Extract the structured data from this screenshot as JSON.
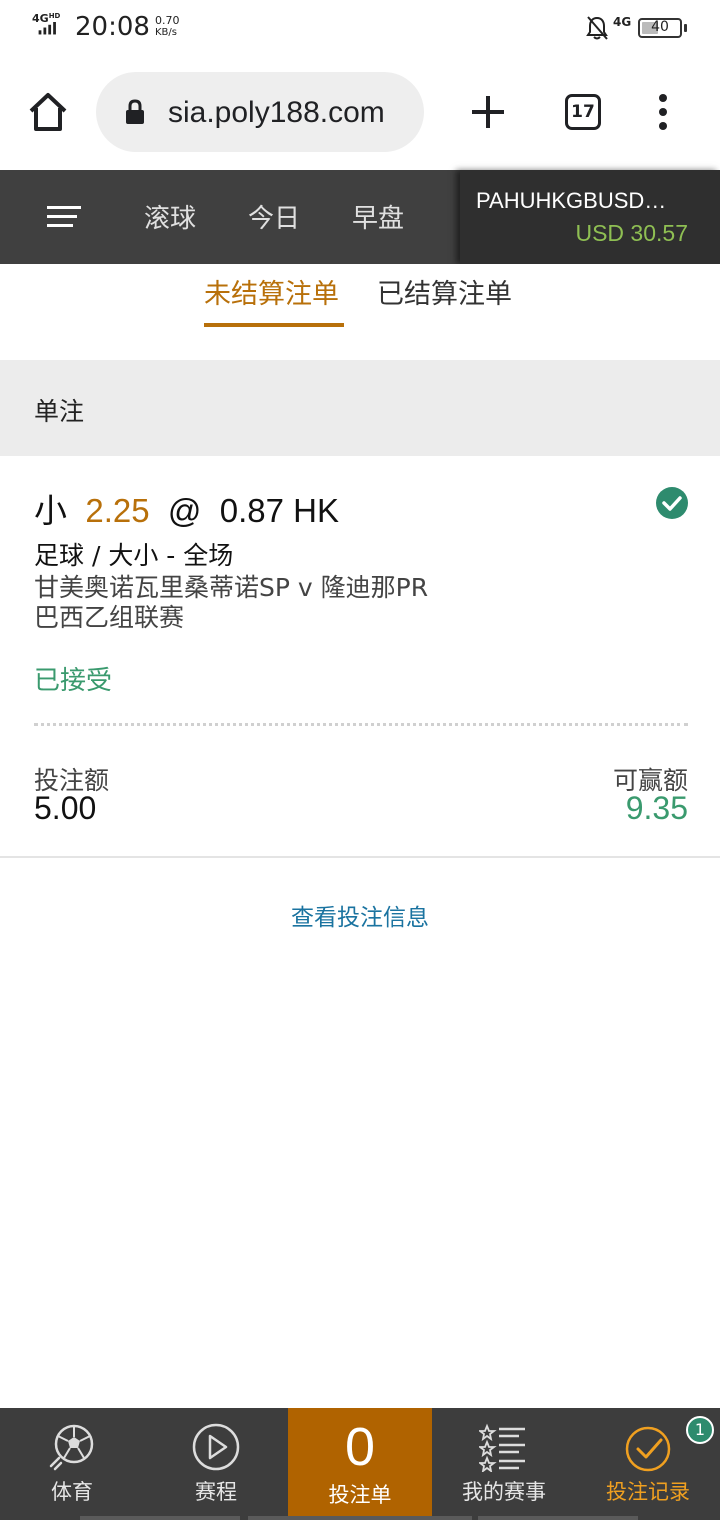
{
  "status_bar": {
    "network": "4G",
    "network_tag": "HD",
    "time": "20:08",
    "speed_value": "0.70",
    "speed_unit": "KB/s",
    "mobile_data": "4G",
    "battery": "40"
  },
  "browser": {
    "url": "sia.poly188.com",
    "tab_count": "17"
  },
  "site_nav": {
    "tabs": [
      {
        "label": "滚球"
      },
      {
        "label": "今日"
      },
      {
        "label": "早盘"
      }
    ],
    "account_name": "PAHUHKGBUSD…",
    "balance": "USD 30.57"
  },
  "bet_tabs": {
    "unsettled": "未结算注单",
    "settled": "已结算注单"
  },
  "section": {
    "title": "单注"
  },
  "bet": {
    "selection": "小",
    "handicap": "2.25",
    "at": "@",
    "odds": "0.87 HK",
    "market": "足球 / 大小 - 全场",
    "match": "甘美奥诺瓦里桑蒂诺SP v 隆迪那PR",
    "league": "巴西乙组联赛",
    "status": "已接受",
    "stake_label": "投注额",
    "stake_value": "5.00",
    "win_label": "可赢额",
    "win_value": "9.35"
  },
  "view_info_link": "查看投注信息",
  "bottom_nav": {
    "sports": "体育",
    "schedule": "赛程",
    "betslip_count": "0",
    "betslip": "投注单",
    "my_events": "我的赛事",
    "records": "投注记录",
    "records_badge": "1"
  },
  "colors": {
    "accent": "#b8700a",
    "success": "#3a9a6e",
    "balance": "#8fbf53",
    "nav_bg": "#404040",
    "link": "#1a73a0"
  }
}
